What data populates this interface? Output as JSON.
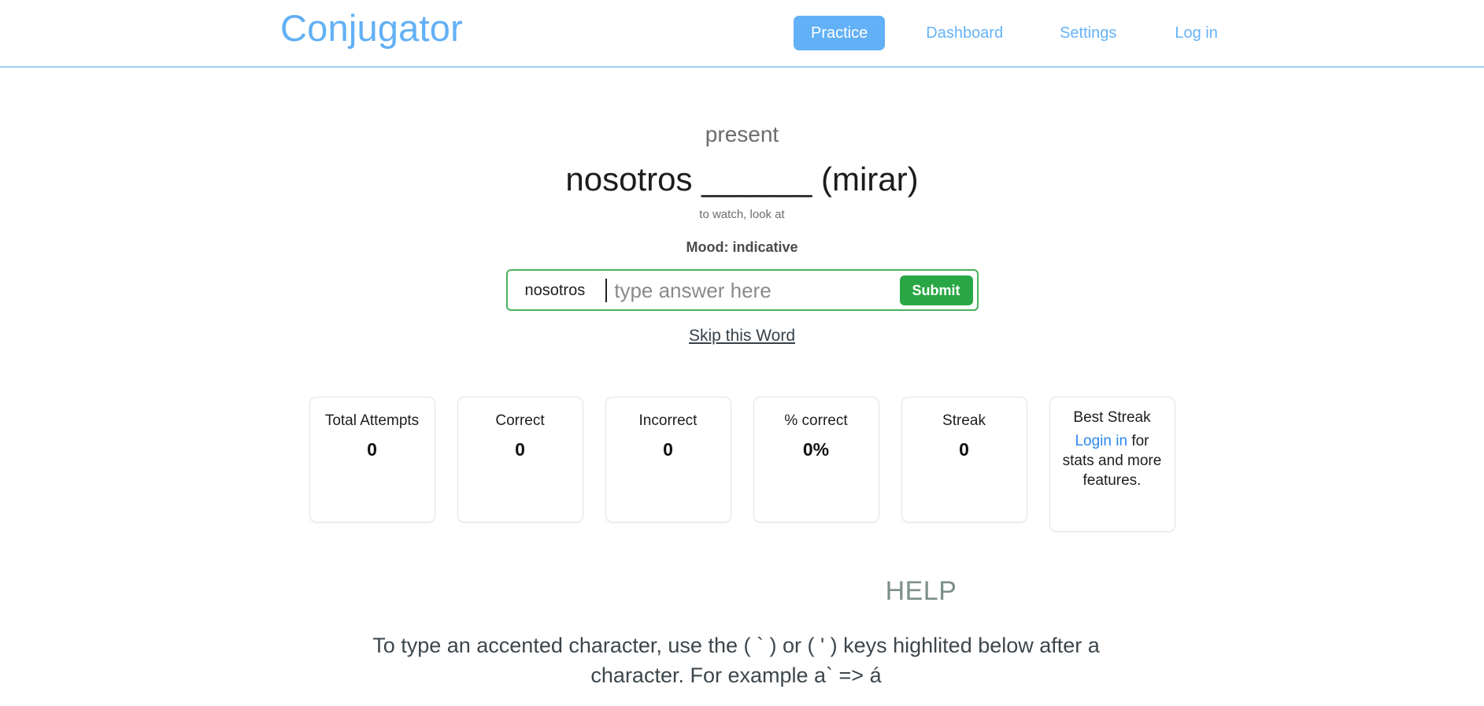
{
  "header": {
    "brand": "Conjugator",
    "nav": [
      {
        "label": "Practice",
        "active": true
      },
      {
        "label": "Dashboard",
        "active": false
      },
      {
        "label": "Settings",
        "active": false
      },
      {
        "label": "Log in",
        "active": false
      }
    ],
    "brand_color": "#62b0f6",
    "active_bg": "#62b0f6"
  },
  "practice": {
    "tense": "present",
    "prompt": "nosotros ______ (mirar)",
    "translation": "to watch, look at",
    "mood": "Mood: indicative",
    "pronoun_prefix": "nosotros",
    "answer_value": "",
    "answer_placeholder": "type answer here",
    "submit_label": "Submit",
    "skip_label": "Skip this Word",
    "submit_color": "#2aa745",
    "input_border_color": "#4cb05c"
  },
  "stats": [
    {
      "label": "Total Attempts",
      "value": "0"
    },
    {
      "label": "Correct",
      "value": "0"
    },
    {
      "label": "Incorrect",
      "value": "0"
    },
    {
      "label": "% correct",
      "value": "0%"
    },
    {
      "label": "Streak",
      "value": "0"
    }
  ],
  "best_streak": {
    "label": "Best Streak",
    "link_label": "Login in",
    "note_rest": " for stats and more features.",
    "link_color": "#2b87f0"
  },
  "help": {
    "title": "HELP",
    "text": "To type an accented character, use the ( ` ) or ( ' ) keys highlited below after a character. For example a` => á",
    "title_color": "#7d8f8c"
  }
}
